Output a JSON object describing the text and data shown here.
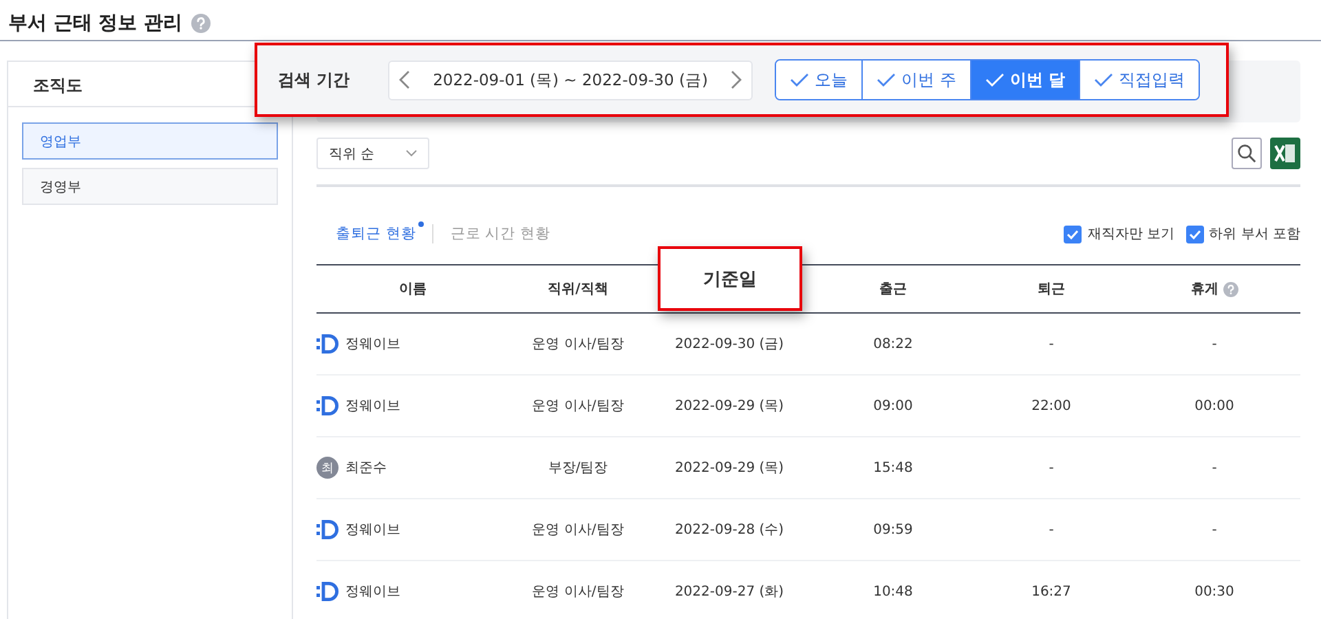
{
  "page": {
    "title": "부서 근태 정보 관리",
    "help": true
  },
  "sidebar": {
    "title": "조직도",
    "items": [
      {
        "label": "영업부",
        "selected": true
      },
      {
        "label": "경영부",
        "selected": false
      }
    ]
  },
  "search_bar": {
    "highlighted": true,
    "label": "검색 기간",
    "range": "2022-09-01 (목) ~ 2022-09-30 (금)",
    "buttons": [
      {
        "label": "오늘",
        "selected": false
      },
      {
        "label": "이번 주",
        "selected": false
      },
      {
        "label": "이번 달",
        "selected": true
      },
      {
        "label": "직접입력",
        "selected": false
      }
    ]
  },
  "sort": {
    "value": "직위 순"
  },
  "tabs": [
    {
      "label": "출퇴근 현황",
      "selected": true,
      "dot": true
    },
    {
      "label": "근로 시간 현황",
      "selected": false,
      "dot": false
    }
  ],
  "filters": [
    {
      "label": "재직자만 보기",
      "checked": true
    },
    {
      "label": "하위 부서 포함",
      "checked": true
    }
  ],
  "table": {
    "columns": [
      {
        "label": "이름",
        "highlighted": false,
        "help": false
      },
      {
        "label": "직위/직책",
        "highlighted": false,
        "help": false
      },
      {
        "label": "기준일",
        "highlighted": true,
        "help": false
      },
      {
        "label": "출근",
        "highlighted": false,
        "help": false
      },
      {
        "label": "퇴근",
        "highlighted": false,
        "help": false
      },
      {
        "label": "휴게",
        "highlighted": false,
        "help": true
      }
    ],
    "rows": [
      {
        "avatar": {
          "kind": "logo"
        },
        "name": "정웨이브",
        "position": "운영 이사/팀장",
        "date": "2022-09-30 (금)",
        "in": "08:22",
        "out": "-",
        "break": "-"
      },
      {
        "avatar": {
          "kind": "logo"
        },
        "name": "정웨이브",
        "position": "운영 이사/팀장",
        "date": "2022-09-29 (목)",
        "in": "09:00",
        "out": "22:00",
        "break": "00:00"
      },
      {
        "avatar": {
          "kind": "initial",
          "text": "최"
        },
        "name": "최준수",
        "position": "부장/팀장",
        "date": "2022-09-29 (목)",
        "in": "15:48",
        "out": "-",
        "break": "-"
      },
      {
        "avatar": {
          "kind": "logo"
        },
        "name": "정웨이브",
        "position": "운영 이사/팀장",
        "date": "2022-09-28 (수)",
        "in": "09:59",
        "out": "-",
        "break": "-"
      },
      {
        "avatar": {
          "kind": "logo"
        },
        "name": "정웨이브",
        "position": "운영 이사/팀장",
        "date": "2022-09-27 (화)",
        "in": "10:48",
        "out": "16:27",
        "break": "00:30"
      }
    ]
  }
}
